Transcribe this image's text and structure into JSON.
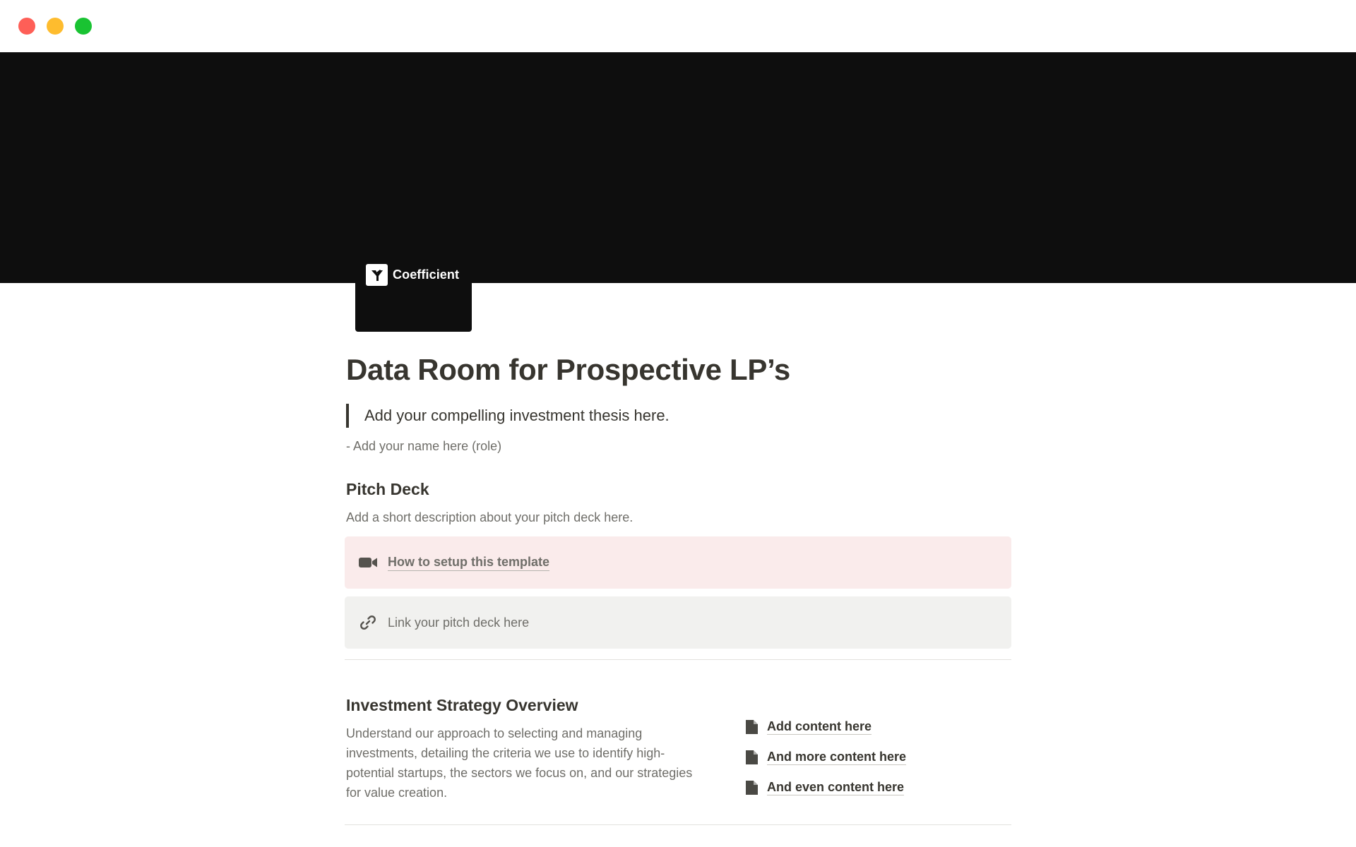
{
  "window": {
    "controls": [
      "close",
      "minimize",
      "zoom"
    ]
  },
  "cover": {
    "color": "#0e0e0e"
  },
  "page_icon": {
    "brand_name": "Coefficient",
    "icon": "coefficient-logo-icon"
  },
  "page": {
    "title": "Data Room for Prospective LP’s",
    "quote": "Add your compelling investment thesis here.",
    "attribution": "- Add your name here (role)"
  },
  "pitch_deck": {
    "heading": "Pitch Deck",
    "description": "Add a short description about your pitch deck here.",
    "video_callout": {
      "icon": "video-camera-icon",
      "label": "How to setup this template",
      "background": "#faebeb"
    },
    "link_callout": {
      "icon": "link-icon",
      "label": "Link your pitch deck here",
      "background": "#f1f1ef"
    }
  },
  "investment_strategy": {
    "heading": "Investment Strategy Overview",
    "description": "Understand our approach to selecting and managing investments, detailing the criteria we use to identify high-potential startups, the sectors we focus on, and our strategies for value creation.",
    "links": [
      {
        "icon": "document-icon",
        "label": "Add content here"
      },
      {
        "icon": "document-icon",
        "label": "And more content here"
      },
      {
        "icon": "document-icon",
        "label": "And even content here"
      }
    ]
  }
}
